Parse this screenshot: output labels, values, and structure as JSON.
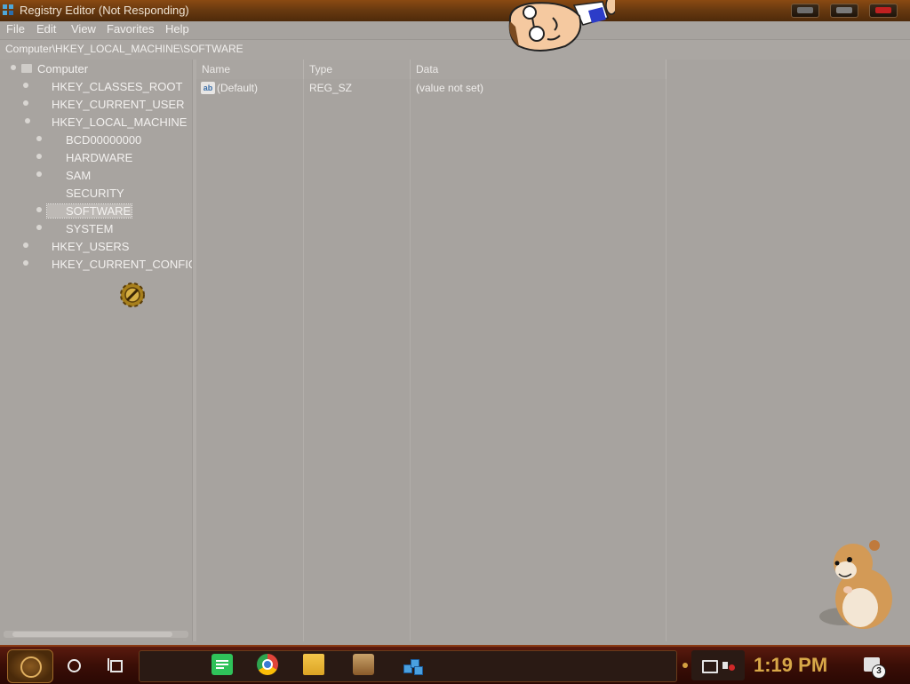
{
  "window": {
    "title": "Registry Editor (Not Responding)"
  },
  "menu": {
    "file": "File",
    "edit": "Edit",
    "view": "View",
    "favorites": "Favorites",
    "help": "Help"
  },
  "address": {
    "path": "Computer\\HKEY_LOCAL_MACHINE\\SOFTWARE"
  },
  "tree": {
    "root": "Computer",
    "hives": [
      "HKEY_CLASSES_ROOT",
      "HKEY_CURRENT_USER",
      "HKEY_LOCAL_MACHINE",
      "HKEY_USERS",
      "HKEY_CURRENT_CONFIG"
    ],
    "local_machine_children": [
      "BCD00000000",
      "HARDWARE",
      "SAM",
      "SECURITY",
      "SOFTWARE",
      "SYSTEM"
    ],
    "selected": "SOFTWARE"
  },
  "list": {
    "columns": [
      "Name",
      "Type",
      "Data"
    ],
    "rows": [
      {
        "name": "(Default)",
        "type": "REG_SZ",
        "data": "(value not set)",
        "icon": "string-value-icon"
      }
    ]
  },
  "taskbar": {
    "clock": "1:19 PM",
    "notification_count": "3",
    "apps": [
      "notes-app-icon",
      "chrome-icon",
      "file-explorer-icon",
      "game-app-icon",
      "regedit-app-icon"
    ]
  },
  "colors": {
    "titlebar": "#6a3a10",
    "taskbar": "#3a0e06",
    "clock_text": "#d8a848",
    "window_bg": "#a7a39f"
  }
}
